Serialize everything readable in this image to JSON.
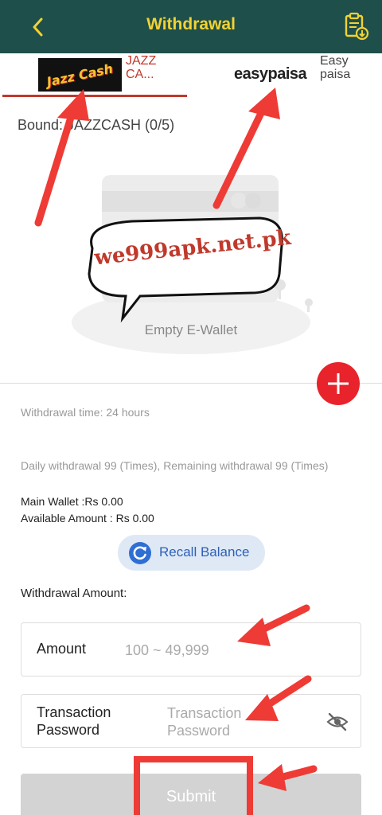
{
  "header": {
    "title": "Withdrawal",
    "back_icon": "chevron-left-icon",
    "records_icon": "clipboard-download-icon",
    "bg_color": "#1f4f4a",
    "title_color": "#f2d233"
  },
  "tabs": [
    {
      "logo_text": "Jazz Cash",
      "label": "JAZZCA..."
    },
    {
      "logo_text": "easypaisa",
      "label": "Easypaisa"
    }
  ],
  "wallet": {
    "bound_label": "Bound: JAZZCASH (0/5)",
    "empty_text": "Empty E-Wallet"
  },
  "watermark": {
    "text": "we999apk.net.pk"
  },
  "info": {
    "withdrawal_time": "Withdrawal time:  24 hours",
    "daily_withdrawal": "Daily withdrawal 99 (Times), Remaining withdrawal 99 (Times)",
    "main_wallet": "Main Wallet :Rs 0.00",
    "available_amount": "Available Amount : Rs 0.00"
  },
  "recall": {
    "label": "Recall Balance",
    "icon": "refresh-icon"
  },
  "form": {
    "section_title": "Withdrawal Amount:",
    "amount_label": "Amount",
    "amount_placeholder": "100 ~ 49,999",
    "password_label": "Transaction Password",
    "password_placeholder": "Transaction Password",
    "eye_icon": "eye-off-icon"
  },
  "submit": {
    "label": "Submit"
  },
  "accent_color": "#e8232b"
}
